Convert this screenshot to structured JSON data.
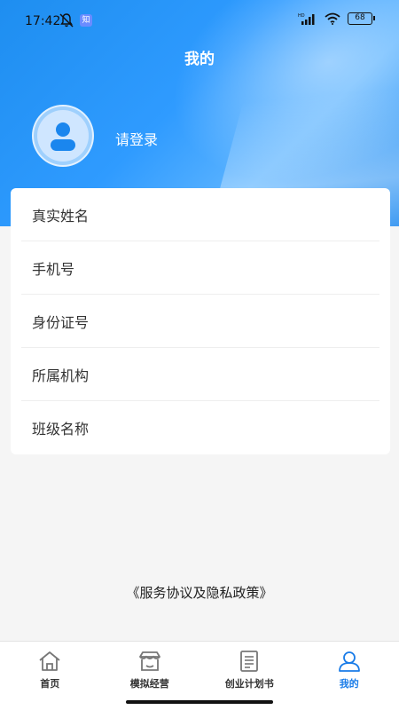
{
  "status_bar": {
    "time": "17:42",
    "badge": "知",
    "network": "HD",
    "battery": "68"
  },
  "header": {
    "title": "我的"
  },
  "profile": {
    "login_text": "请登录"
  },
  "info_rows": [
    {
      "label": "真实姓名"
    },
    {
      "label": "手机号"
    },
    {
      "label": "身份证号"
    },
    {
      "label": "所属机构"
    },
    {
      "label": "班级名称"
    }
  ],
  "agreement": "《服务协议及隐私政策》",
  "tabbar": {
    "items": [
      {
        "label": "首页",
        "icon": "home-icon",
        "active": false
      },
      {
        "label": "模拟经营",
        "icon": "store-icon",
        "active": false
      },
      {
        "label": "创业计划书",
        "icon": "document-icon",
        "active": false
      },
      {
        "label": "我的",
        "icon": "user-icon",
        "active": true
      }
    ]
  },
  "colors": {
    "accent": "#1a7ce8",
    "header": "#2f9bff"
  }
}
